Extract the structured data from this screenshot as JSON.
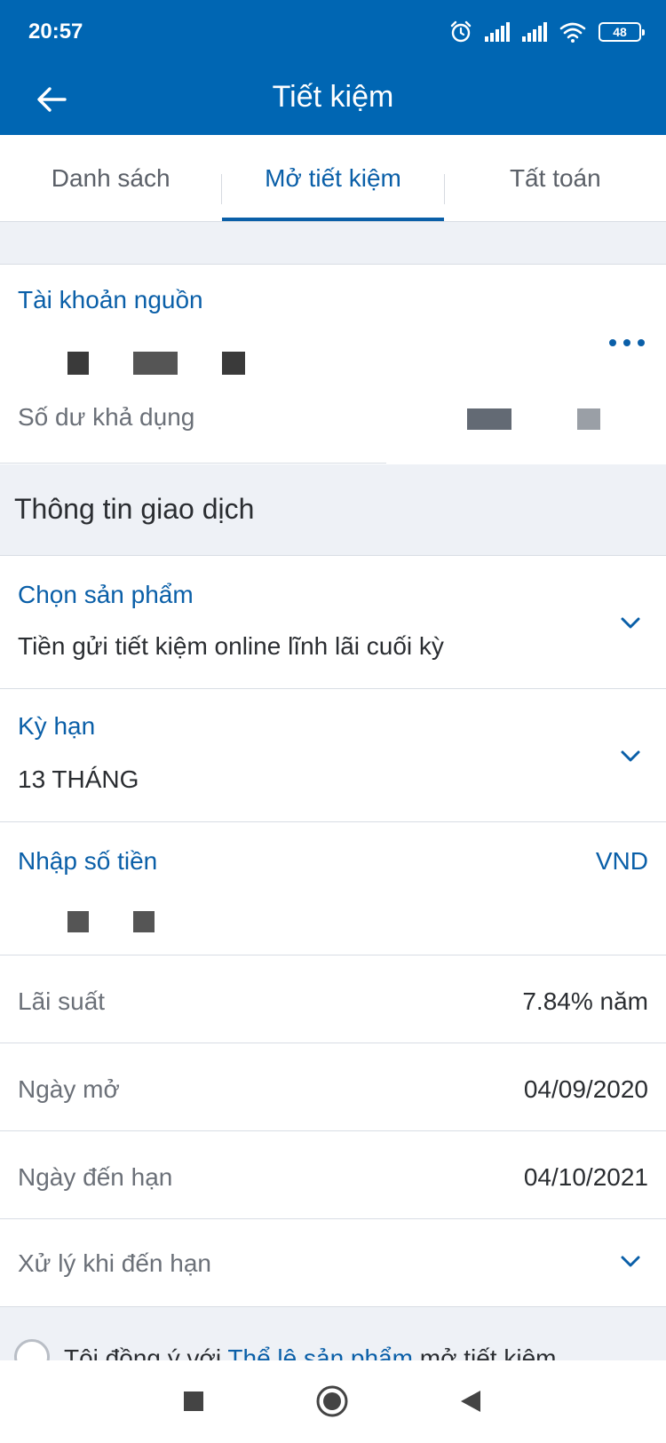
{
  "status": {
    "time": "20:57",
    "battery": "48"
  },
  "header": {
    "title": "Tiết kiệm"
  },
  "tabs": [
    {
      "label": "Danh sách",
      "active": false
    },
    {
      "label": "Mở tiết kiệm",
      "active": true
    },
    {
      "label": "Tất toán",
      "active": false
    }
  ],
  "source": {
    "label": "Tài khoản nguồn",
    "balance_label": "Số dư khả dụng"
  },
  "section": {
    "title": "Thông tin giao dịch"
  },
  "product": {
    "label": "Chọn sản phẩm",
    "value": "Tiền gửi tiết kiệm online lĩnh lãi cuối kỳ"
  },
  "term": {
    "label": "Kỳ hạn",
    "value": "13 THÁNG"
  },
  "amount": {
    "label": "Nhập số tiền",
    "currency": "VND"
  },
  "rate": {
    "label": "Lãi suất",
    "value": "7.84% năm"
  },
  "open_date": {
    "label": "Ngày mở",
    "value": "04/09/2020"
  },
  "due_date": {
    "label": "Ngày đến hạn",
    "value": "04/10/2021"
  },
  "maturity": {
    "label": "Xử lý khi đến hạn"
  },
  "consent": {
    "prefix": "Tôi đồng ý với ",
    "link": "Thể lệ sản phẩm",
    "suffix": " mở tiết kiệm"
  },
  "colors": {
    "brand": "#0066b3",
    "accent": "#0a5fa8",
    "background": "#eef1f6"
  }
}
